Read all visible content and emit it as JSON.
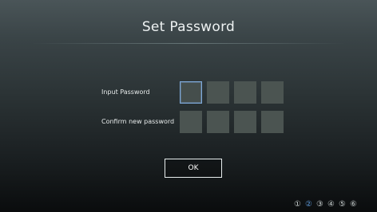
{
  "header": {
    "title": "Set Password"
  },
  "form": {
    "input_label": "Input Password",
    "confirm_label": "Confirm new password",
    "input_boxes": [
      "",
      "",
      "",
      ""
    ],
    "confirm_boxes": [
      "",
      "",
      "",
      ""
    ],
    "focused_field": "input-password-digit-1"
  },
  "actions": {
    "ok_label": "OK"
  },
  "steps": {
    "items": [
      "①",
      "②",
      "③",
      "④",
      "⑤",
      "⑥"
    ],
    "current": 2
  },
  "colors": {
    "accent": "#7ea9d9",
    "active_step": "#5e9bdc",
    "pin_box": "#4b5451"
  }
}
